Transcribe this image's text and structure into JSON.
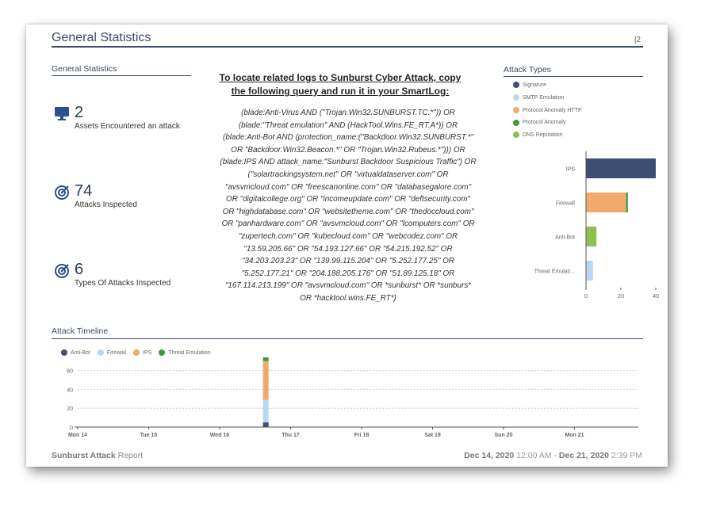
{
  "header": {
    "title": "General Statistics",
    "page": "|2"
  },
  "general": {
    "title": "General Statistics",
    "stats": [
      {
        "value": "2",
        "label": "Assets Encountered an attack",
        "icon": "monitor-icon"
      },
      {
        "value": "74",
        "label": "Attacks Inspected",
        "icon": "target-icon"
      },
      {
        "value": "6",
        "label": "Types Of Attacks Inspected",
        "icon": "target-icon"
      }
    ]
  },
  "query": {
    "title_lines": [
      "To locate related logs to Sunburst Cyber Attack, copy",
      "the following query and run it in your SmartLog:"
    ],
    "lines": [
      "(blade:Anti-Virus AND (\"Trojan.Win32.SUNBURST.TC.*\")) OR",
      "(blade:\"Threat emulation\" AND (HackTool.Wins.FE_RT.A*)) OR",
      "(blade:Anti-Bot AND (protection_name:(\"Backdoor.Win32.SUNBURST.*\"",
      "OR \"Backdoor.Win32.Beacon.*\" OR \"Trojan.Win32.Rubeus.*\"))) OR",
      "(blade:IPS AND attack_name:\"Sunburst Backdoor Suspicious Traffic\") OR",
      "(\"solartrackingsystem.net\" OR \"virtualdataserver.com\" OR",
      "\"avsvmcloud.com\" OR \"freescanonline.com\" OR \"databasegalore.com\"",
      "OR \"digitalcollege.org\" OR \"incomeupdate.com\" OR \"deftsecurity.com\"",
      "OR \"highdatabase.com\" OR \"websitetheme.com\" OR \"thedoccloud.com\"",
      "OR \"panhardware.com\" OR \"avsvmcloud.com\" OR \"lcomputers.com\" OR",
      "\"zupertech.com\" OR \"kubecloud.com\" OR \"webcodez.com\" OR",
      "\"13.59.205.66\" OR \"54.193.127.66\" OR \"54.215.192.52\" OR",
      "\"34.203.203.23\" OR \"139.99.115.204\" OR \"5.252.177.25\" OR",
      "\"5.252.177.21\" OR \"204.188.205.176\" OR \"51.89.125.18\" OR",
      "\"167.114.213.199\" OR \"avsvmcloud.com\" OR *sunburst* OR *sunburs*",
      "OR *hacktool.wins.FE_RT*)"
    ]
  },
  "colors": {
    "navy": "#3b4a6b",
    "signature": "#3e4e72",
    "smtp": "#b9d7ef",
    "protocol_http": "#f2a96a",
    "protocol_anomaly": "#3c9a3c",
    "dns": "#8cc152"
  },
  "attack_types_title": "Attack Types",
  "timeline_title": "Attack Timeline",
  "chart_data": [
    {
      "type": "bar",
      "orientation": "horizontal",
      "stacked": true,
      "title": "Attack Types",
      "categories": [
        "IPS",
        "Firewall",
        "Anti-Bot",
        "Threat Emulati..."
      ],
      "series": [
        {
          "name": "Signature",
          "color": "#3e4e72",
          "values": [
            40,
            0,
            0,
            0
          ]
        },
        {
          "name": "SMTP Emulation",
          "color": "#b9d7ef",
          "values": [
            0,
            0,
            0,
            4
          ]
        },
        {
          "name": "Protocol Anomaly HTTP",
          "color": "#f2a96a",
          "values": [
            0,
            23,
            0,
            0
          ]
        },
        {
          "name": "Protocol Anomaly",
          "color": "#3c9a3c",
          "values": [
            0,
            1,
            0,
            0
          ]
        },
        {
          "name": "DNS Reputation",
          "color": "#8cc152",
          "values": [
            0,
            0,
            6,
            0
          ]
        }
      ],
      "xlim": [
        0,
        40
      ],
      "xticks": [
        0,
        20,
        40
      ],
      "legend": "top"
    },
    {
      "type": "bar",
      "stacked": true,
      "title": "Attack Timeline",
      "categories": [
        "Mon 14",
        "Tue 15",
        "Wed 16",
        "Thu 17",
        "Fri 18",
        "Sat 19",
        "Sun 20",
        "Mon 21"
      ],
      "bar_position": 2.65,
      "series": [
        {
          "name": "Anti-Bot",
          "color": "#3e4e72",
          "value": 5
        },
        {
          "name": "Firewall",
          "color": "#b9d7ef",
          "value": 24
        },
        {
          "name": "IPS",
          "color": "#f2a96a",
          "value": 41
        },
        {
          "name": "Threat Emulation",
          "color": "#3c9a3c",
          "value": 4
        }
      ],
      "ylim": [
        0,
        74
      ],
      "yticks": [
        0,
        20,
        40,
        60
      ],
      "grid": true,
      "legend": "top-left"
    }
  ],
  "footer": {
    "report_bold": "Sunburst Attack",
    "report_rest": " Report",
    "date_start": "Dec 14, 2020",
    "time_start": " 12:00 AM - ",
    "date_end": "Dec 21, 2020",
    "time_end": " 2:39 PM"
  }
}
